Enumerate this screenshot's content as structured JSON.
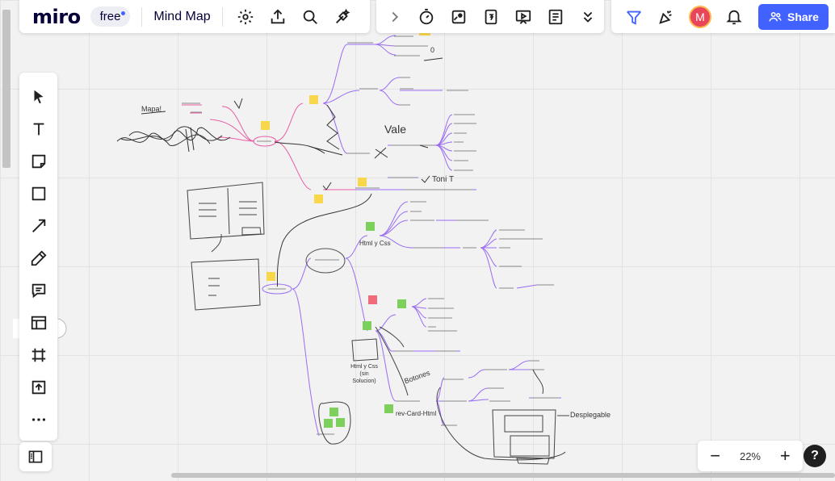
{
  "app": {
    "logo": "miro",
    "plan_badge": "free",
    "board_title": "Mind Map"
  },
  "colors": {
    "accent": "#4262ff",
    "sticky_yellow": "#f8d74a",
    "sticky_green": "#7ed05c",
    "sticky_red": "#f16c7a",
    "branch_pink": "#e85fa7",
    "branch_purple": "#9a6cf2"
  },
  "top_left_icons": [
    "settings-icon",
    "upload-icon",
    "search-icon",
    "magic-icon"
  ],
  "top_center_icons": [
    "chevron-right-icon",
    "timer-icon",
    "voting-icon",
    "countdown-icon",
    "present-icon",
    "notes-icon",
    "chevron-down-icon"
  ],
  "top_right": {
    "share_label": "Share",
    "avatar_initial": "M",
    "icons": [
      "filter-icon",
      "celebrate-icon",
      "bell-icon"
    ]
  },
  "tools": [
    "cursor-tool",
    "text-tool",
    "sticky-note-tool",
    "shape-tool",
    "arrow-tool",
    "pen-tool",
    "comment-tool",
    "template-tool",
    "frame-tool",
    "upload-tool",
    "more-tool"
  ],
  "zoom": {
    "value": "22%",
    "minus": "−",
    "plus": "+"
  },
  "help": {
    "label": "?"
  },
  "canvas_text": {
    "mapa": "Mapa!",
    "vale": "Vale",
    "toni": "Toni T",
    "html_css": "Html y Css",
    "html_css_sin": "Html y Css (sin Solucion)",
    "botones": "Botones",
    "desplegable": "Desplegable",
    "rev_card": "rev-Card-Html",
    "zero": "0"
  }
}
